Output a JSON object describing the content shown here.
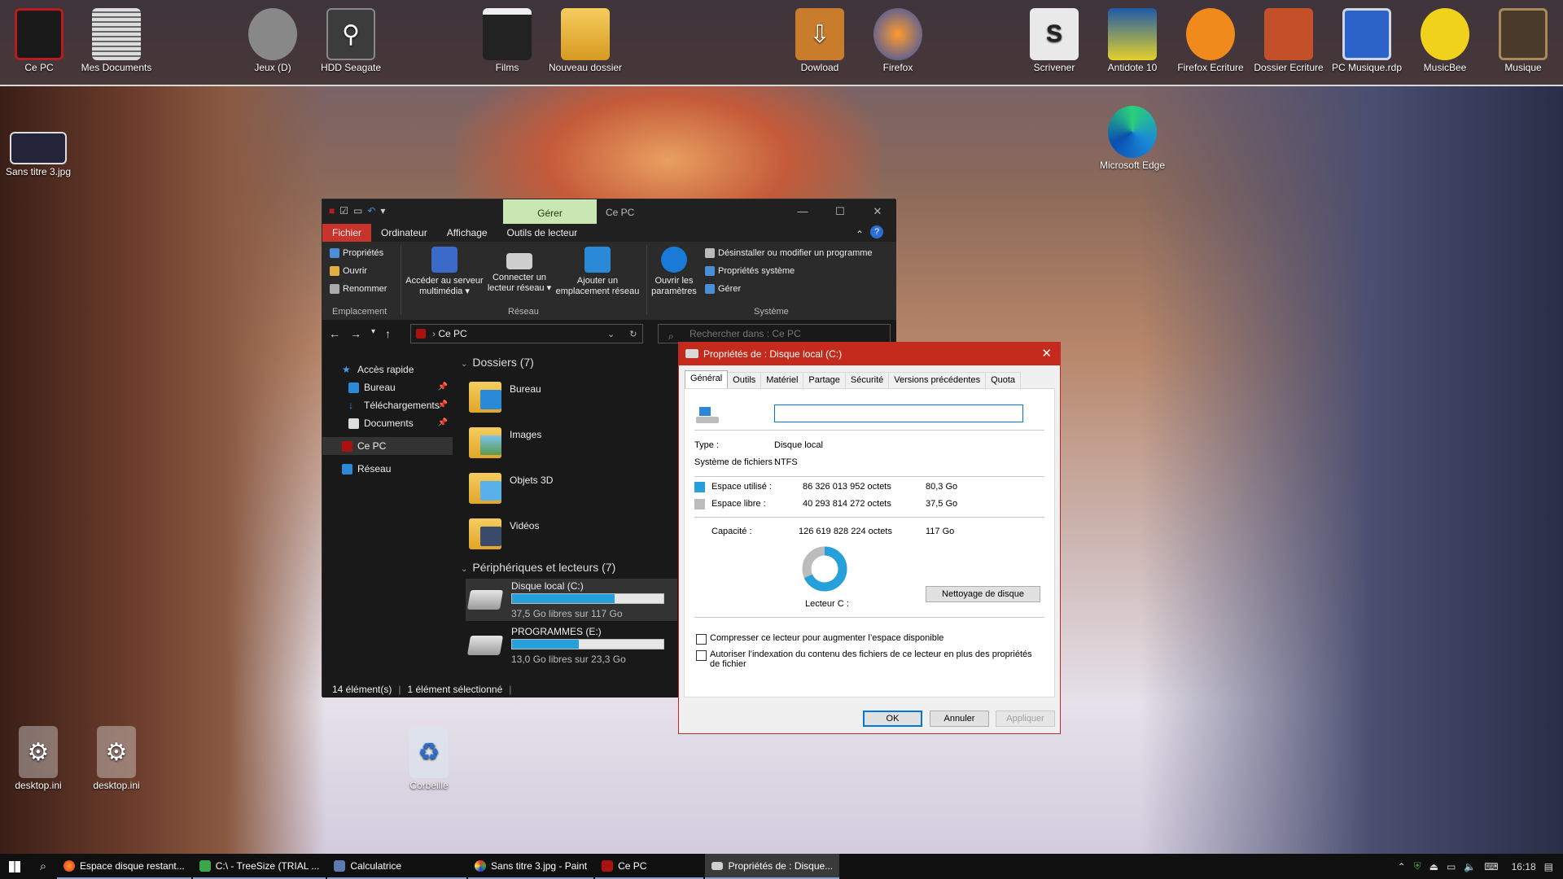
{
  "desktop": {
    "top_icons": [
      {
        "label": "Ce PC",
        "icon": "pc-red-icon"
      },
      {
        "label": "Mes Documents",
        "icon": "notebook-icon"
      },
      {
        "label": "Jeux (D)",
        "icon": "hard-drive-icon"
      },
      {
        "label": "HDD Seagate",
        "icon": "usb-icon"
      },
      {
        "label": "Films",
        "icon": "clapperboard-icon"
      },
      {
        "label": "Nouveau dossier",
        "icon": "folder-icon"
      },
      {
        "label": "Dowload",
        "icon": "download-folder-icon"
      },
      {
        "label": "Firefox",
        "icon": "firefox-icon"
      },
      {
        "label": "Scrivener",
        "icon": "scrivener-icon"
      },
      {
        "label": "Antidote 10",
        "icon": "flask-icon"
      },
      {
        "label": "Firefox Ecriture",
        "icon": "firefox-dark-icon"
      },
      {
        "label": "Dossier Ecriture",
        "icon": "chest-icon"
      },
      {
        "label": "PC Musique.rdp",
        "icon": "remote-desktop-icon"
      },
      {
        "label": "MusicBee",
        "icon": "bee-icon"
      },
      {
        "label": "Musique",
        "icon": "radio-icon"
      }
    ],
    "side_icons": [
      {
        "label": "Sans titre 3.jpg",
        "icon": "image-file-icon"
      },
      {
        "label": "Microsoft Edge",
        "icon": "edge-icon"
      },
      {
        "label": "desktop.ini",
        "icon": "settings-file-icon"
      },
      {
        "label": "desktop.ini",
        "icon": "settings-file-icon"
      },
      {
        "label": "Corbeille",
        "icon": "recycle-bin-icon"
      }
    ]
  },
  "explorer": {
    "title": "Ce PC",
    "context_tab": "Gérer",
    "win_controls": {
      "minimize": "—",
      "maximize": "☐",
      "close": "✕"
    },
    "ribbon_tabs": [
      "Fichier",
      "Ordinateur",
      "Affichage",
      "Outils de lecteur"
    ],
    "ribbon": {
      "emplacement": {
        "group": "Emplacement",
        "items": [
          "Propriétés",
          "Ouvrir",
          "Renommer"
        ]
      },
      "reseau": {
        "group": "Réseau",
        "items": [
          {
            "l1": "Accéder au serveur",
            "l2": "multimédia ▾"
          },
          {
            "l1": "Connecter un",
            "l2": "lecteur réseau ▾"
          },
          {
            "l1": "Ajouter un",
            "l2": "emplacement réseau"
          }
        ]
      },
      "systeme": {
        "group": "Système",
        "big": {
          "l1": "Ouvrir les",
          "l2": "paramètres"
        },
        "items": [
          "Désinstaller ou modifier un programme",
          "Propriétés système",
          "Gérer"
        ]
      }
    },
    "address": "Ce PC",
    "search_placeholder": "Rechercher dans : Ce PC",
    "nav": [
      {
        "label": "Accès rapide",
        "pin": false
      },
      {
        "label": "Bureau",
        "pin": true
      },
      {
        "label": "Téléchargements",
        "pin": true
      },
      {
        "label": "Documents",
        "pin": true
      },
      {
        "label": "Ce PC",
        "pin": false
      },
      {
        "label": "Réseau",
        "pin": false
      }
    ],
    "folders_header": "Dossiers (7)",
    "folders": [
      "Bureau",
      "Images",
      "Objets 3D",
      "Vidéos"
    ],
    "devices_header": "Périphériques et lecteurs (7)",
    "drives": [
      {
        "name": "Disque local (C:)",
        "free": "37,5 Go libres sur 117 Go",
        "used_fraction": 0.68
      },
      {
        "name": "PROGRAMMES (E:)",
        "free": "13,0 Go libres sur 23,3 Go",
        "used_fraction": 0.44
      }
    ],
    "status": {
      "count": "14 élément(s)",
      "selected": "1 élément sélectionné"
    }
  },
  "dialog": {
    "title": "Propriétés de : Disque local (C:)",
    "close": "✕",
    "tabs": [
      "Général",
      "Outils",
      "Matériel",
      "Partage",
      "Sécurité",
      "Versions précédentes",
      "Quota"
    ],
    "label_value": "",
    "type_label": "Type :",
    "type_value": "Disque local",
    "fs_label": "Système de fichiers :",
    "fs_value": "NTFS",
    "used_label": "Espace utilisé :",
    "used_bytes": "86 326 013 952 octets",
    "used_gb": "80,3 Go",
    "free_label": "Espace libre :",
    "free_bytes": "40 293 814 272 octets",
    "free_gb": "37,5 Go",
    "cap_label": "Capacité :",
    "cap_bytes": "126 619 828 224 octets",
    "cap_gb": "117 Go",
    "drive_label": "Lecteur C :",
    "cleanup_btn": "Nettoyage de disque",
    "used_fraction": 0.682,
    "used_color": "#26a0da",
    "free_color": "#bcbcbc",
    "compress_label": "Compresser ce lecteur pour augmenter l’espace disponible",
    "index_label": "Autoriser l’indexation du contenu des fichiers de ce lecteur en plus des propriétés de fichier",
    "ok": "OK",
    "cancel": "Annuler",
    "apply": "Appliquer"
  },
  "taskbar": {
    "items": [
      {
        "label": "Espace disque restant...",
        "icon": "firefox-icon",
        "active": false
      },
      {
        "label": "C:\\ - TreeSize (TRIAL ...",
        "icon": "treesize-icon",
        "active": false
      },
      {
        "label": "Calculatrice",
        "icon": "calculator-icon",
        "active": false
      },
      {
        "label": "Sans titre 3.jpg - Paint",
        "icon": "paint-icon",
        "active": false
      },
      {
        "label": "Ce PC",
        "icon": "pc-red-icon",
        "active": false
      },
      {
        "label": "Propriétés de : Disque...",
        "icon": "drive-icon",
        "active": true
      }
    ],
    "clock": "16:18"
  }
}
